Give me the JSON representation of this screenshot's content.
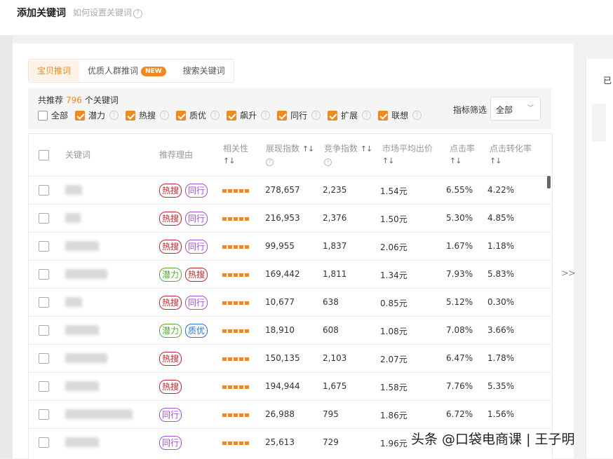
{
  "header": {
    "title": "添加关键词",
    "help_text": "如何设置关键词"
  },
  "tabs": [
    {
      "label": "宝贝推词",
      "active": true
    },
    {
      "label": "优质人群推词",
      "badge": "NEW"
    },
    {
      "label": "搜索关键词"
    }
  ],
  "filter": {
    "rec_prefix": "共推荐",
    "rec_count": "796",
    "rec_suffix": "个关键词",
    "checkboxes": [
      {
        "label": "全部",
        "checked": false
      },
      {
        "label": "潜力",
        "checked": true
      },
      {
        "label": "热搜",
        "checked": true
      },
      {
        "label": "质优",
        "checked": true
      },
      {
        "label": "飙升",
        "checked": true
      },
      {
        "label": "同行",
        "checked": true
      },
      {
        "label": "扩展",
        "checked": true
      },
      {
        "label": "联想",
        "checked": true
      }
    ],
    "metric_label": "指标筛选",
    "metric_value": "全部"
  },
  "table": {
    "columns": {
      "keyword": "关键词",
      "reason": "推荐理由",
      "relevance": "相关性",
      "impressions": "展现指数",
      "competition": "竞争指数",
      "avg_bid": "市场平均出价",
      "ctr": "点击率",
      "cvr": "点击转化率"
    },
    "rows": [
      {
        "tags": [
          {
            "t": "热搜",
            "c": "red"
          },
          {
            "t": "同行",
            "c": "purple"
          }
        ],
        "impressions": "278,657",
        "competition": "2,235",
        "avg_bid": "1.54元",
        "ctr": "6.55%",
        "cvr": "4.22%"
      },
      {
        "tags": [
          {
            "t": "热搜",
            "c": "red"
          },
          {
            "t": "同行",
            "c": "purple"
          }
        ],
        "impressions": "216,953",
        "competition": "2,376",
        "avg_bid": "1.50元",
        "ctr": "5.30%",
        "cvr": "4.85%"
      },
      {
        "tags": [
          {
            "t": "热搜",
            "c": "red"
          },
          {
            "t": "同行",
            "c": "purple"
          }
        ],
        "impressions": "99,955",
        "competition": "1,837",
        "avg_bid": "2.06元",
        "ctr": "1.67%",
        "cvr": "1.18%"
      },
      {
        "tags": [
          {
            "t": "潜力",
            "c": "green"
          },
          {
            "t": "热搜",
            "c": "red"
          }
        ],
        "impressions": "169,442",
        "competition": "1,811",
        "avg_bid": "1.34元",
        "ctr": "7.93%",
        "cvr": "5.83%"
      },
      {
        "tags": [
          {
            "t": "热搜",
            "c": "red"
          },
          {
            "t": "同行",
            "c": "purple"
          }
        ],
        "impressions": "10,677",
        "competition": "638",
        "avg_bid": "0.85元",
        "ctr": "5.12%",
        "cvr": "0.30%"
      },
      {
        "tags": [
          {
            "t": "潜力",
            "c": "green"
          },
          {
            "t": "质优",
            "c": "blue"
          }
        ],
        "impressions": "18,910",
        "competition": "608",
        "avg_bid": "1.08元",
        "ctr": "7.08%",
        "cvr": "3.66%"
      },
      {
        "tags": [
          {
            "t": "热搜",
            "c": "red"
          }
        ],
        "impressions": "150,135",
        "competition": "2,103",
        "avg_bid": "2.07元",
        "ctr": "6.47%",
        "cvr": "1.78%"
      },
      {
        "tags": [
          {
            "t": "热搜",
            "c": "red"
          }
        ],
        "impressions": "194,944",
        "competition": "1,675",
        "avg_bid": "1.58元",
        "ctr": "7.76%",
        "cvr": "5.35%"
      },
      {
        "tags": [
          {
            "t": "同行",
            "c": "purple"
          }
        ],
        "impressions": "26,988",
        "competition": "795",
        "avg_bid": "1.86元",
        "ctr": "6.72%",
        "cvr": "1.56%"
      },
      {
        "tags": [
          {
            "t": "同行",
            "c": "purple"
          }
        ],
        "impressions": "25,613",
        "competition": "729",
        "avg_bid": "1.96元",
        "ctr": "",
        "cvr": ""
      }
    ]
  },
  "side": {
    "arrow": ">>",
    "label": "已"
  },
  "watermark": "头条 @口袋电商课 | 王子明",
  "colors": {
    "accent": "#f08a1f",
    "tag_red": "#c2262f",
    "tag_purple": "#a54fd1",
    "tag_green": "#5aa83c",
    "tag_blue": "#2b6fd6"
  }
}
